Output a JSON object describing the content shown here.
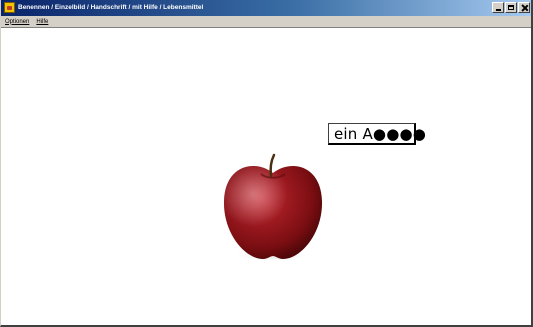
{
  "window": {
    "title": "Benennen / Einzelbild / Handschrift / mit Hilfe / Lebensmittel",
    "icon": "app-icon",
    "caption_buttons": [
      "minimize-icon",
      "maximize-icon",
      "close-icon"
    ]
  },
  "menu": {
    "items": [
      {
        "label": "Optionen"
      },
      {
        "label": "Hilfe"
      }
    ]
  },
  "exercise": {
    "image_subject": "apple-image",
    "answer_text": "ein A●●●●"
  },
  "colors": {
    "titlebar_start": "#0a246a",
    "titlebar_end": "#a6caf0",
    "menubar": "#d4d0c8",
    "apple_red": "#8e1519"
  }
}
